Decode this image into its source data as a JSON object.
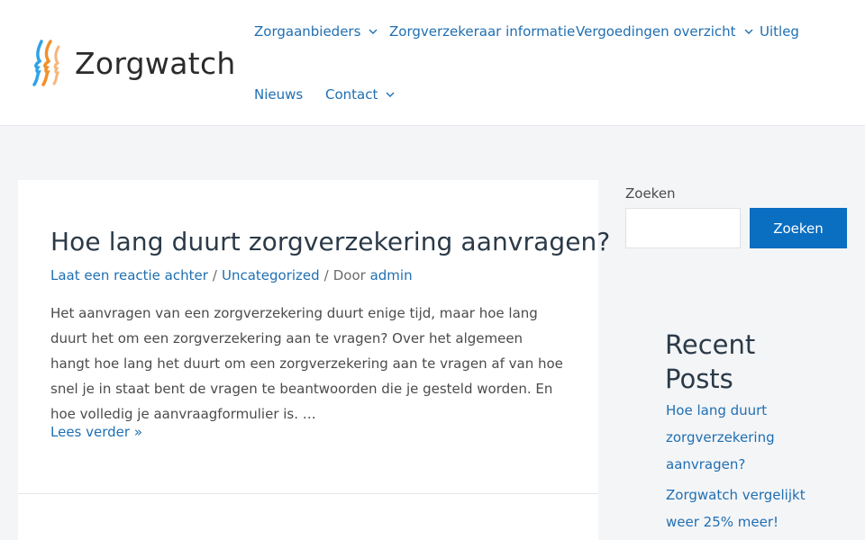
{
  "site": {
    "title": "Zorgwatch",
    "logo_icon": "zorgwatch-faces-logo-icon",
    "colors": {
      "link": "#1f6fb2",
      "button": "#0a6ec1",
      "logo_orange": "#f0902a",
      "logo_blue": "#2fa3e6"
    }
  },
  "nav": {
    "items": [
      {
        "label": "Zorgaanbieders",
        "has_dropdown": true
      },
      {
        "label": "Zorgverzekeraar informatie",
        "has_dropdown": false
      },
      {
        "label": "Vergoedingen overzicht",
        "has_dropdown": true
      },
      {
        "label": "Uitleg",
        "has_dropdown": false
      },
      {
        "label": "Nieuws",
        "has_dropdown": false
      },
      {
        "label": "Contact",
        "has_dropdown": true
      }
    ],
    "dropdown_icon": "chevron-down-icon"
  },
  "post": {
    "title": "Hoe lang duurt zorgverzekering aanvragen?",
    "meta": {
      "comment_link": "Laat een reactie achter",
      "separator": "/",
      "category": "Uncategorized",
      "author_prefix": "Door",
      "author": "admin"
    },
    "excerpt": "Het aanvragen van een zorgverzekering duurt enige tijd, maar hoe lang duurt het om een zorgverzekering aan te vragen? Over het algemeen hangt hoe lang het duurt om een zorgverzekering aan te vragen af van hoe snel je in staat bent de vragen te beantwoorden die je gesteld worden. En hoe volledig je aanvraagformulier is. …",
    "read_more": "Lees verder »"
  },
  "sidebar": {
    "search": {
      "label": "Zoeken",
      "value": "",
      "placeholder": "",
      "button": "Zoeken"
    },
    "recent_posts": {
      "title": "Recent Posts",
      "items": [
        "Hoe lang duurt zorgverzekering aanvragen?",
        "Zorgwatch vergelijkt weer 25% meer!"
      ]
    }
  }
}
